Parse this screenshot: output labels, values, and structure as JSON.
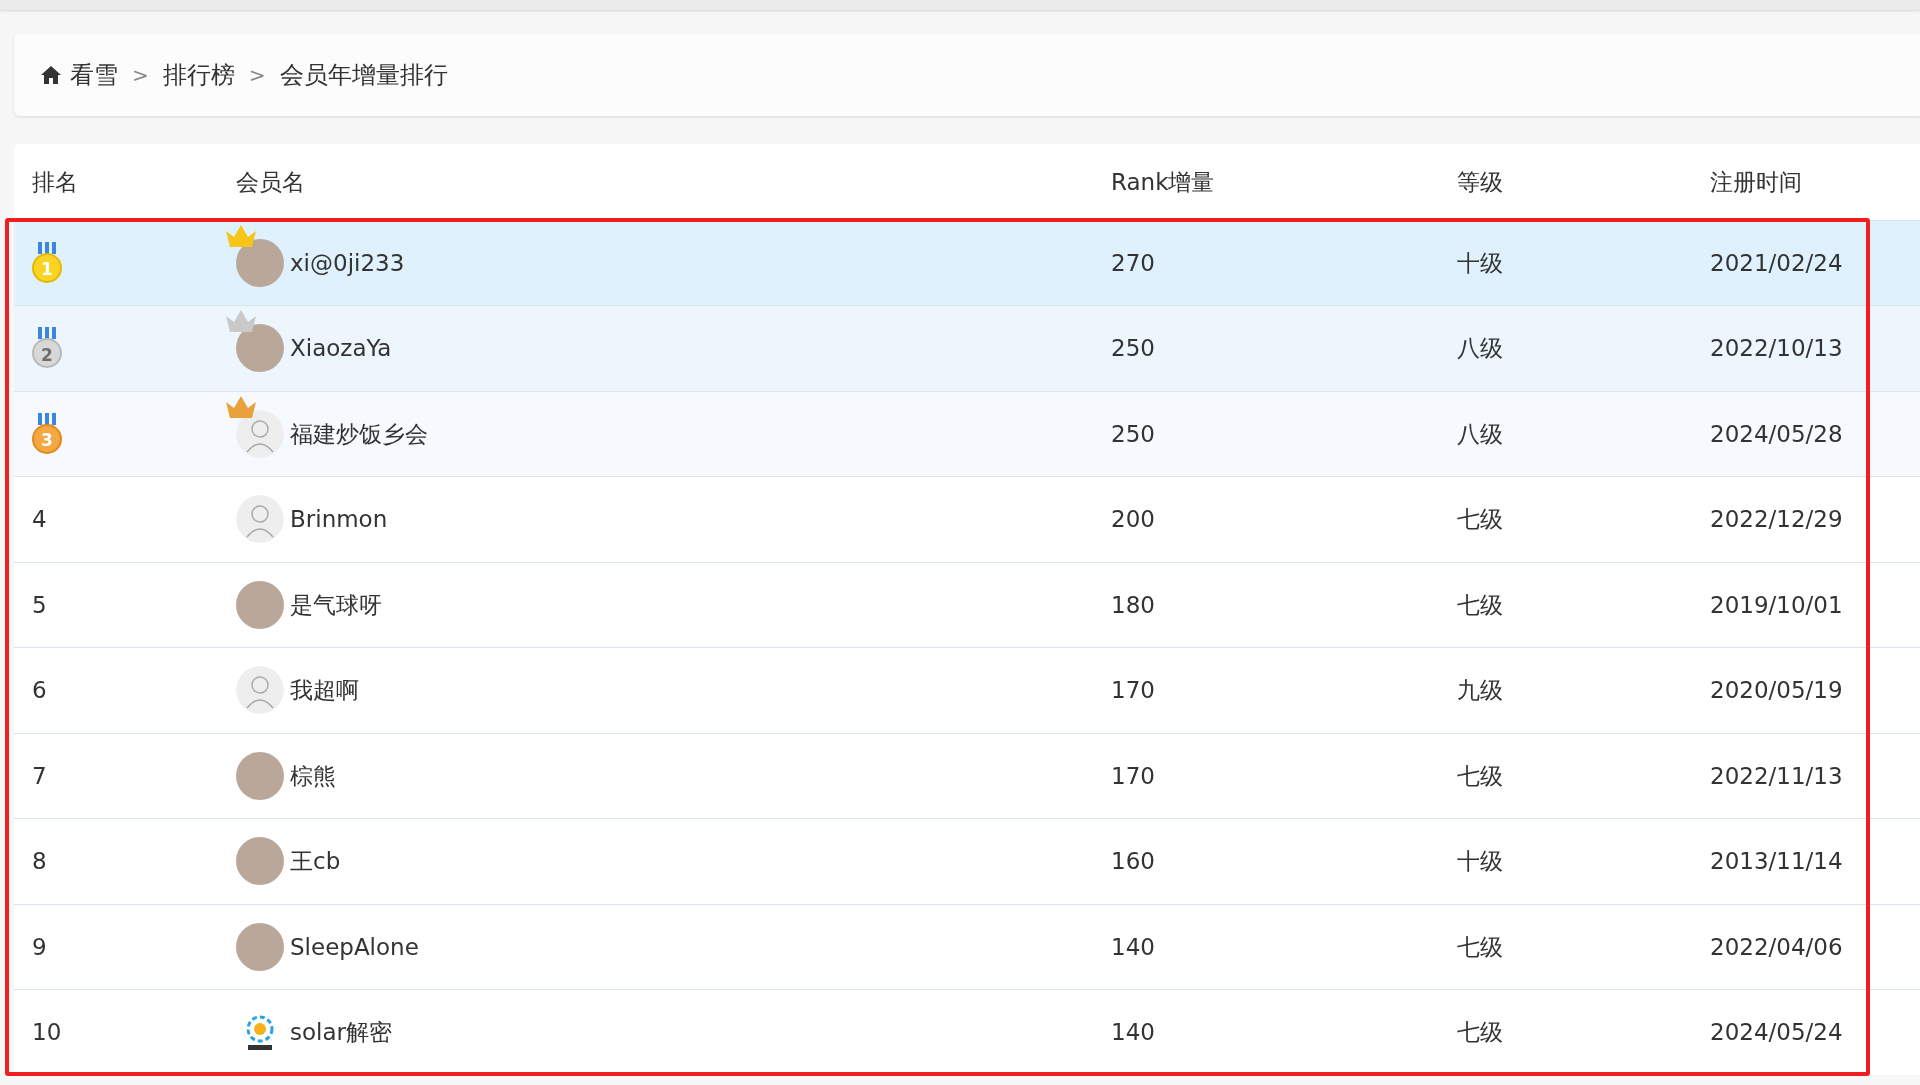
{
  "breadcrumb": [
    {
      "label": "看雪",
      "kind": "home"
    },
    {
      "label": "排行榜",
      "kind": "link"
    },
    {
      "label": "会员年增量排行",
      "kind": "link"
    }
  ],
  "separator": ">",
  "table": {
    "columns": [
      "排名",
      "会员名",
      "Rank增量",
      "等级",
      "注册时间"
    ],
    "rows": [
      {
        "rank": "1",
        "kind": "gold",
        "avatar": {
          "kind": "photo"
        },
        "name": "xi@0ji233",
        "increase": "270",
        "level": "十级",
        "registered": "2021/02/24"
      },
      {
        "rank": "2",
        "kind": "silver",
        "avatar": {
          "kind": "photo"
        },
        "name": "XiaozaYa",
        "increase": "250",
        "level": "八级",
        "registered": "2022/10/13"
      },
      {
        "rank": "3",
        "kind": "bronze",
        "avatar": {
          "kind": "default"
        },
        "name": "福建炒饭乡会",
        "increase": "250",
        "level": "八级",
        "registered": "2024/05/28"
      },
      {
        "rank": "4",
        "kind": "plain",
        "avatar": {
          "kind": "default"
        },
        "name": "Brinmon",
        "increase": "200",
        "level": "七级",
        "registered": "2022/12/29"
      },
      {
        "rank": "5",
        "kind": "plain",
        "avatar": {
          "kind": "photo"
        },
        "name": "是气球呀",
        "increase": "180",
        "level": "七级",
        "registered": "2019/10/01"
      },
      {
        "rank": "6",
        "kind": "plain",
        "avatar": {
          "kind": "default"
        },
        "name": "我超啊",
        "increase": "170",
        "level": "九级",
        "registered": "2020/05/19"
      },
      {
        "rank": "7",
        "kind": "plain",
        "avatar": {
          "kind": "photo"
        },
        "name": "棕熊",
        "increase": "170",
        "level": "七级",
        "registered": "2022/11/13"
      },
      {
        "rank": "8",
        "kind": "plain",
        "avatar": {
          "kind": "photo"
        },
        "name": "王cb",
        "increase": "160",
        "level": "十级",
        "registered": "2013/11/14"
      },
      {
        "rank": "9",
        "kind": "plain",
        "avatar": {
          "kind": "photo"
        },
        "name": "SleepAlone",
        "increase": "140",
        "level": "七级",
        "registered": "2022/04/06"
      },
      {
        "rank": "10",
        "kind": "plain",
        "avatar": {
          "kind": "logo"
        },
        "name": "solar解密",
        "increase": "140",
        "level": "七级",
        "registered": "2024/05/24"
      }
    ]
  },
  "highlight_frame": true
}
